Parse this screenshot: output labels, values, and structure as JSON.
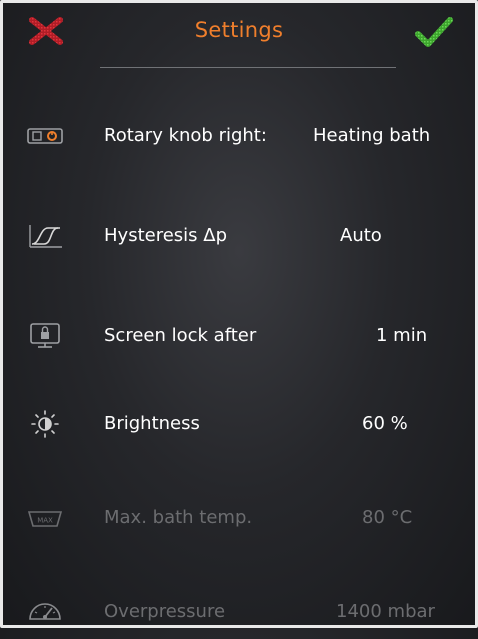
{
  "header": {
    "title": "Settings",
    "cancel_icon": "close-icon",
    "confirm_icon": "checkmark-icon",
    "colors": {
      "title": "#f07f2c",
      "cancel": "#c8202a",
      "confirm": "#4cc23a"
    }
  },
  "settings": [
    {
      "icon": "rotary-knob-icon",
      "label": "Rotary knob right:",
      "value": "Heating bath",
      "enabled": true
    },
    {
      "icon": "hysteresis-icon",
      "label": "Hysteresis Δp",
      "value": "Auto",
      "enabled": true
    },
    {
      "icon": "screen-lock-icon",
      "label": "Screen lock after",
      "value": "1 min",
      "enabled": true
    },
    {
      "icon": "brightness-icon",
      "label": "Brightness",
      "value": "60 %",
      "enabled": true
    },
    {
      "icon": "bath-temperature-icon",
      "icon_text": "MAX",
      "label": "Max. bath temp.",
      "value": "80 °C",
      "enabled": false
    },
    {
      "icon": "overpressure-icon",
      "label": "Overpressure",
      "value": "1400 mbar",
      "enabled": false
    }
  ]
}
